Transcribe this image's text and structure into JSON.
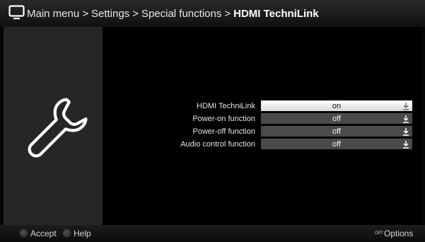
{
  "header": {
    "icon": "tv-icon",
    "breadcrumb": [
      {
        "label": "Main menu"
      },
      {
        "label": "Settings"
      },
      {
        "label": "Special functions"
      }
    ],
    "current": "HDMI TechniLink",
    "separator": ">"
  },
  "side_panel": {
    "icon": "wrench-icon"
  },
  "settings": [
    {
      "label": "HDMI TechniLink",
      "value": "on",
      "selected": true
    },
    {
      "label": "Power-on function",
      "value": "off",
      "selected": false
    },
    {
      "label": "Power-off function",
      "value": "off",
      "selected": false
    },
    {
      "label": "Audio control function",
      "value": "off",
      "selected": false
    }
  ],
  "footer": {
    "accept_label": "Accept",
    "help_label": "Help",
    "options_badge": "OPT",
    "options_label": "Options"
  },
  "colors": {
    "background": "#000000",
    "panel": "#262626",
    "field": "#4a4a4a",
    "selected_field": "#ffffff",
    "text": "#ffffff"
  }
}
